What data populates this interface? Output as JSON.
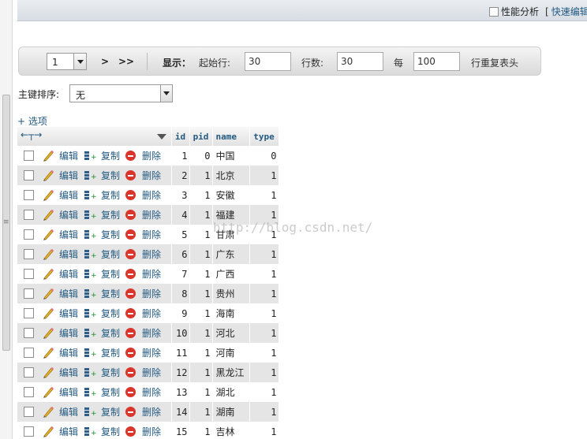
{
  "topbar": {
    "profiling_label": "性能分析",
    "bracket": "[",
    "quick_edit_label": "快速编辑"
  },
  "navigation": {
    "page_select_value": "1",
    "next_label": ">",
    "last_label": ">>",
    "display_label": "显示：",
    "start_row_label": "起始行:",
    "start_row_value": "30",
    "rows_label": "行数:",
    "rows_value": "30",
    "per_label": "每",
    "repeat_value": "100",
    "repeat_suffix": "行重复表头"
  },
  "sort": {
    "label": "主键排序:",
    "selected": "无"
  },
  "options_link": "+ 选项",
  "table": {
    "columns": [
      "id",
      "pid",
      "name",
      "type"
    ],
    "actions": {
      "edit": "编辑",
      "copy": "复制",
      "delete": "删除"
    },
    "rows": [
      {
        "id": "1",
        "pid": "0",
        "name": "中国",
        "type": "0"
      },
      {
        "id": "2",
        "pid": "1",
        "name": "北京",
        "type": "1"
      },
      {
        "id": "3",
        "pid": "1",
        "name": "安徽",
        "type": "1"
      },
      {
        "id": "4",
        "pid": "1",
        "name": "福建",
        "type": "1"
      },
      {
        "id": "5",
        "pid": "1",
        "name": "甘肃",
        "type": "1"
      },
      {
        "id": "6",
        "pid": "1",
        "name": "广东",
        "type": "1"
      },
      {
        "id": "7",
        "pid": "1",
        "name": "广西",
        "type": "1"
      },
      {
        "id": "8",
        "pid": "1",
        "name": "贵州",
        "type": "1"
      },
      {
        "id": "9",
        "pid": "1",
        "name": "海南",
        "type": "1"
      },
      {
        "id": "10",
        "pid": "1",
        "name": "河北",
        "type": "1"
      },
      {
        "id": "11",
        "pid": "1",
        "name": "河南",
        "type": "1"
      },
      {
        "id": "12",
        "pid": "1",
        "name": "黑龙江",
        "type": "1"
      },
      {
        "id": "13",
        "pid": "1",
        "name": "湖北",
        "type": "1"
      },
      {
        "id": "14",
        "pid": "1",
        "name": "湖南",
        "type": "1"
      },
      {
        "id": "15",
        "pid": "1",
        "name": "吉林",
        "type": "1"
      }
    ]
  },
  "watermark": "http://blog.csdn.net/"
}
